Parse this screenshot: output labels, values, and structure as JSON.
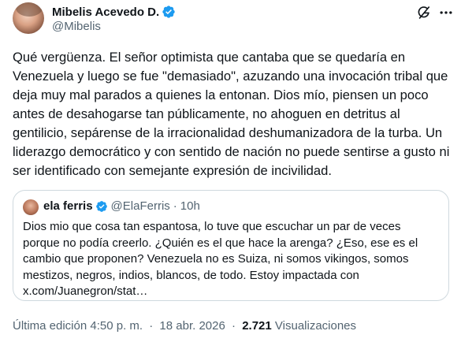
{
  "author": {
    "name": "Mibelis Acevedo D.",
    "handle": "@Mibelis"
  },
  "tweet": {
    "text": "Qué vergüenza. El señor optimista que cantaba que se quedaría en Venezuela y luego se fue \"demasiado\", azuzando una invocación tribal que deja muy mal parados a quienes la entonan. Dios mío, piensen un poco antes de desahogarse tan públicamente, no ahoguen en detritus al gentilicio, sepárense de la irracionalidad deshumanizadora de la turba. Un liderazgo democrático y con sentido de nación no puede sentirse a gusto ni ser identificado con semejante expresión de incivilidad."
  },
  "quote": {
    "name": "ela ferris",
    "handle": "@ElaFerris",
    "separator": "·",
    "time": "10h",
    "text": "Dios mio que cosa tan espantosa, lo tuve que escuchar un par de veces porque no podía creerlo. ¿Quién es el que hace la arenga? ¿Eso, ese es el cambio que proponen?  Venezuela no es Suiza, ni somos vikingos, somos mestizos, negros, indios, blancos, de todo.  Estoy impactada con x.com/Juanegron/stat…"
  },
  "meta": {
    "edited": "Última edición 4:50 p. m.",
    "separator": "·",
    "date": "18 abr. 2026",
    "views_count": "2.721",
    "views_label": "Visualizaciones"
  },
  "colors": {
    "verified": "#1d9bf0",
    "secondary_text": "#536471",
    "primary_text": "#0f1419",
    "border": "#cfd9de"
  },
  "icons": {
    "verified": "verified-badge-icon",
    "grok": "grok-icon",
    "more": "more-options-icon"
  }
}
